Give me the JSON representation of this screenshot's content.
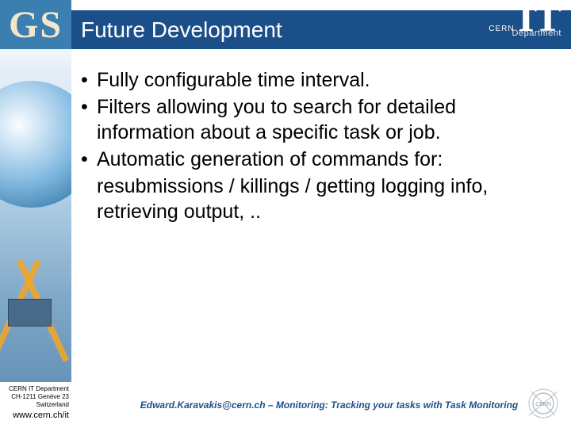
{
  "header": {
    "gs_label": "GS",
    "title": "Future Development",
    "logo": {
      "org": "CERN",
      "dept_short": "IT",
      "dept_full": "Department"
    }
  },
  "bullets": [
    {
      "text": "Fully configurable time interval."
    },
    {
      "text": "Filters allowing you to search for detailed information about a specific task or job."
    },
    {
      "text": "Automatic generation of commands for:",
      "sub": "resubmissions / killings / getting logging info, retrieving output, .."
    }
  ],
  "sidebar_footer": {
    "line1": "CERN IT Department",
    "line2": "CH-1211 Genève 23",
    "line3": "Switzerland",
    "url": "www.cern.ch/it"
  },
  "footer": {
    "credit": "Edward.Karavakis@cern.ch – Monitoring: Tracking your tasks with Task Monitoring"
  }
}
